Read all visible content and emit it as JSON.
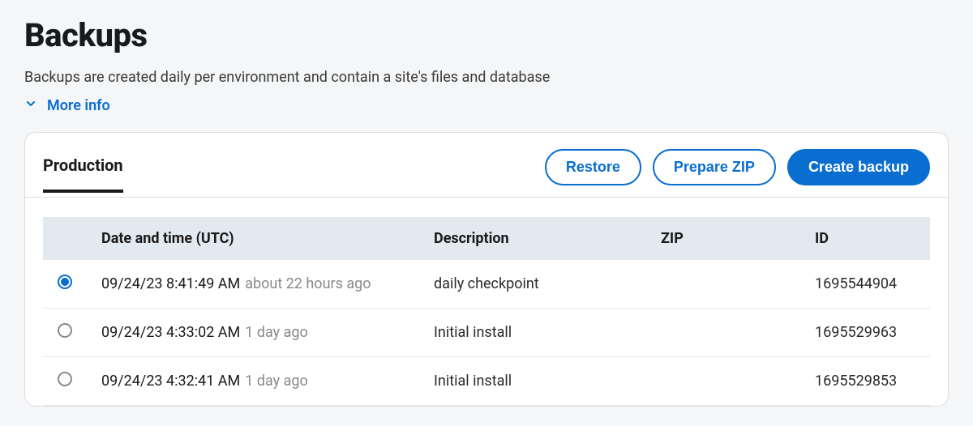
{
  "page": {
    "title": "Backups",
    "subtitle": "Backups are created daily per environment and contain a site's files and database",
    "more_info": "More info"
  },
  "tabs": {
    "active": "Production"
  },
  "actions": {
    "restore": "Restore",
    "prepare_zip": "Prepare ZIP",
    "create_backup": "Create backup"
  },
  "table": {
    "headers": {
      "datetime": "Date and time (UTC)",
      "description": "Description",
      "zip": "ZIP",
      "id": "ID"
    },
    "rows": [
      {
        "selected": true,
        "datetime": "09/24/23 8:41:49 AM",
        "relative": "about 22 hours ago",
        "description": "daily checkpoint",
        "zip": "",
        "id": "1695544904"
      },
      {
        "selected": false,
        "datetime": "09/24/23 4:33:02 AM",
        "relative": "1 day ago",
        "description": "Initial install",
        "zip": "",
        "id": "1695529963"
      },
      {
        "selected": false,
        "datetime": "09/24/23 4:32:41 AM",
        "relative": "1 day ago",
        "description": "Initial install",
        "zip": "",
        "id": "1695529853"
      }
    ]
  }
}
